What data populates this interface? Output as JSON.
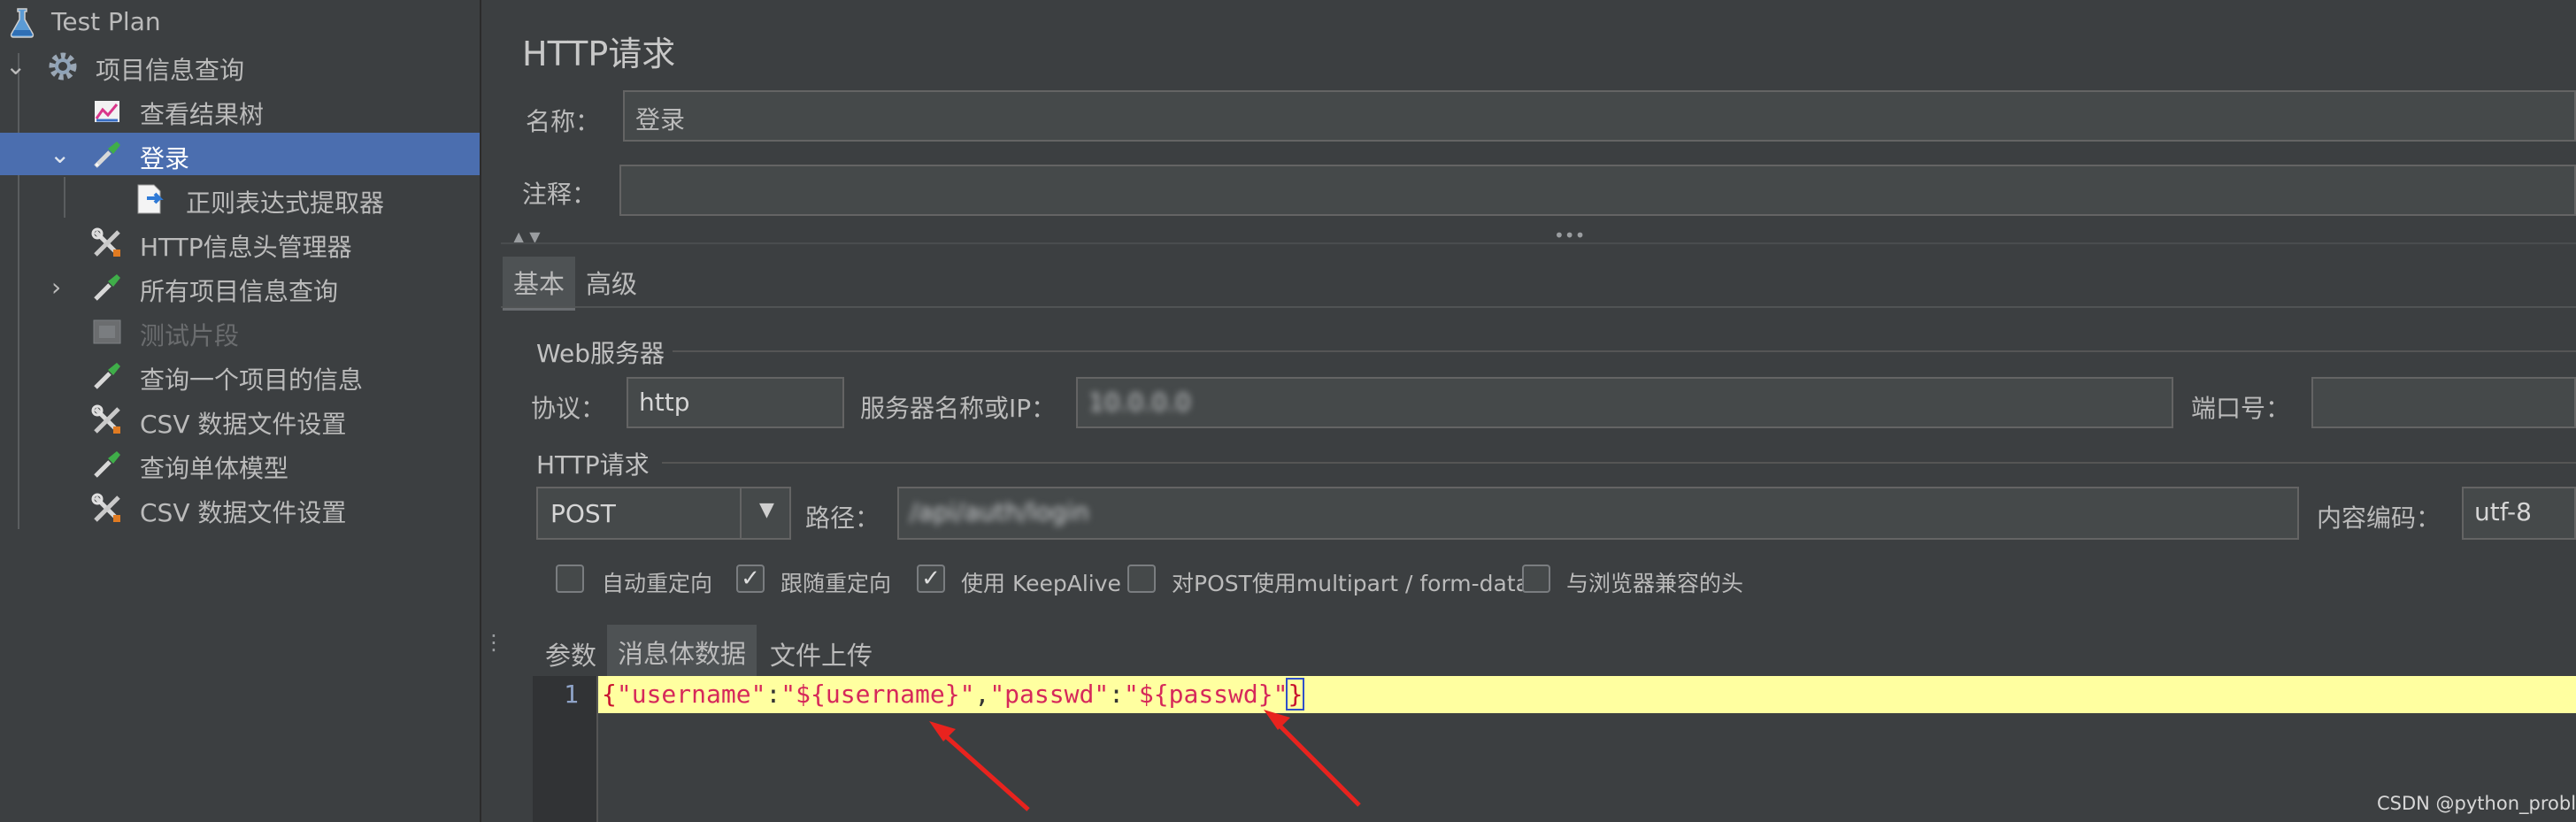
{
  "tree": {
    "items": [
      {
        "label": "Test Plan",
        "icon": "flask-icon"
      },
      {
        "label": "项目信息查询",
        "icon": "gear-icon"
      },
      {
        "label": "查看结果树",
        "icon": "chart-icon"
      },
      {
        "label": "登录",
        "icon": "pipette-icon"
      },
      {
        "label": "正则表达式提取器",
        "icon": "extractor-icon"
      },
      {
        "label": "HTTP信息头管理器",
        "icon": "wrench-icon"
      },
      {
        "label": "所有项目信息查询",
        "icon": "pipette-icon"
      },
      {
        "label": "测试片段",
        "icon": "fragment-icon"
      },
      {
        "label": "查询一个项目的信息",
        "icon": "pipette-icon"
      },
      {
        "label": "CSV 数据文件设置",
        "icon": "wrench-icon"
      },
      {
        "label": "查询单体模型",
        "icon": "pipette-icon"
      },
      {
        "label": "CSV 数据文件设置",
        "icon": "wrench-icon"
      }
    ]
  },
  "panel": {
    "title": "HTTP请求",
    "name_label": "名称：",
    "name_value": "登录",
    "comment_label": "注释：",
    "comment_value": "",
    "collapse_arrows": "▲▼",
    "drag_dots": "•••",
    "tabs": {
      "basic": "基本",
      "advanced": "高级"
    }
  },
  "web_server": {
    "legend": "Web服务器",
    "protocol_label": "协议：",
    "protocol_value": "http",
    "server_label": "服务器名称或IP：",
    "server_value": "10.0.0.0",
    "port_label": "端口号：",
    "port_value": ""
  },
  "http_request": {
    "legend": "HTTP请求",
    "method_value": "POST",
    "path_label": "路径：",
    "path_value": "/api/auth/login",
    "encoding_label": "内容编码：",
    "encoding_value": "utf-8"
  },
  "options": [
    {
      "label": "自动重定向",
      "checked": false
    },
    {
      "label": "跟随重定向",
      "checked": true
    },
    {
      "label": "使用 KeepAlive",
      "checked": true
    },
    {
      "label": "对POST使用multipart / form-data",
      "checked": false
    },
    {
      "label": "与浏览器兼容的头",
      "checked": false
    }
  ],
  "check_mark": "✓",
  "body_tabs": {
    "params": "参数",
    "body": "消息体数据",
    "upload": "文件上传"
  },
  "editor": {
    "line_number": "1",
    "brace_open": "{",
    "k1": "\"username\"",
    "colon1": ":",
    "v1": "\"${username}\"",
    "comma": ",",
    "k2": "\"passwd\"",
    "colon2": ":",
    "v2": "\"${passwd}\"",
    "brace_close": "}"
  },
  "watermark": "CSDN @python_problem",
  "colors": {
    "background": "#3c3f41",
    "selection": "#4b6eaf",
    "editor_highlight": "#ffffa0",
    "json_string": "#d6285a",
    "annotation_arrow": "#e8231e"
  }
}
